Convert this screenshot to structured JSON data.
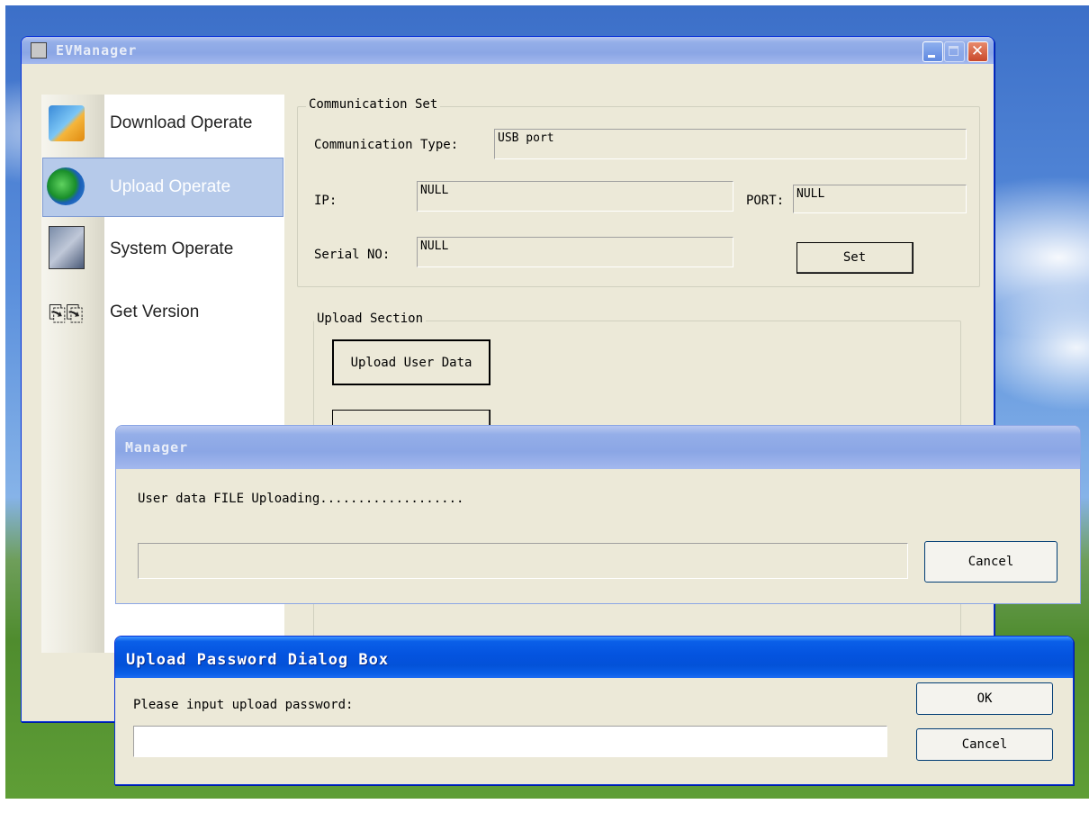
{
  "main_window": {
    "title": "EVManager",
    "nav": [
      {
        "label": "Download Operate",
        "icon": "download-icon"
      },
      {
        "label": "Upload Operate",
        "icon": "upload-icon",
        "selected": true
      },
      {
        "label": "System Operate",
        "icon": "system-tools-icon"
      },
      {
        "label": "Get Version",
        "icon": "version-icon"
      }
    ],
    "comm_set": {
      "legend": "Communication Set",
      "type_label": "Communication Type:",
      "type_value": "USB port",
      "ip_label": "IP:",
      "ip_value": "NULL",
      "port_label": "PORT:",
      "port_value": "NULL",
      "serial_label": "Serial NO:",
      "serial_value": "NULL",
      "set_button": "Set"
    },
    "upload_section": {
      "legend": "Upload Section",
      "upload_user_data_button": "Upload User Data"
    }
  },
  "progress_dialog": {
    "title": "Manager",
    "message": "User data FILE Uploading...................",
    "progress": 0,
    "cancel_button": "Cancel"
  },
  "password_dialog": {
    "title": "Upload Password Dialog Box",
    "prompt": "Please input upload password:",
    "password_value": "",
    "ok_button": "OK",
    "cancel_button": "Cancel"
  },
  "colors": {
    "xp_title_blue": "#0453df",
    "dialog_face": "#ece9d8",
    "nav_selected": "#b6caea"
  }
}
